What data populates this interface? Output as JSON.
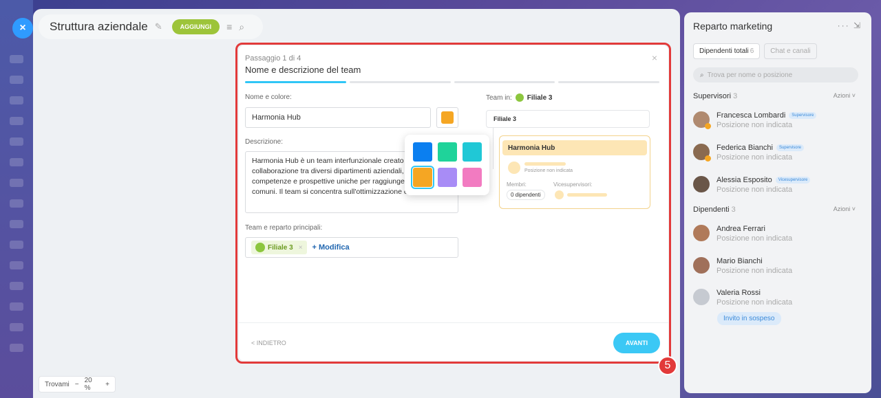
{
  "app": {
    "title": "Struttura aziendale",
    "add_label": "AGGIUNGI",
    "close_icon": "close-icon",
    "pin_icon": "pin-icon",
    "menu_icon": "menu-icon",
    "search_icon": "search-icon"
  },
  "zoom": {
    "label": "Trovami",
    "minus": "−",
    "value": "20",
    "unit": "%",
    "plus": "+"
  },
  "dialog": {
    "step": "Passaggio 1 di 4",
    "title": "Nome e descrizione del team",
    "progress": {
      "current": 1,
      "total": 4
    },
    "name_label": "Nome e colore:",
    "name_value": "Harmonia Hub",
    "selected_color": "#f5a623",
    "palette": [
      "#0b7ff0",
      "#1fd39a",
      "#20c8d6",
      "#f5a623",
      "#a88cf6",
      "#f27bc1"
    ],
    "desc_label": "Descrizione:",
    "desc_value": "Harmonia Hub è un team interfunzionale creato per la collaborazione tra diversi dipartimenti aziendali, unendo competenze e prospettive uniche per raggiungere obiettivi comuni. Il team si concentra sull'ottimizzazione e l'innovazione",
    "parent_label": "Team e reparto principali:",
    "parent_chip": "Filiale 3",
    "parent_chip_remove": "×",
    "modifica": "+ Modifica",
    "team_in_label": "Team in:",
    "team_in_value": "Filiale 3",
    "tree_root": "Filiale 3",
    "card_title": "Harmonia Hub",
    "card_position": "Posizione non indicata",
    "card_members_label": "Membri:",
    "card_members_value": "0 dipendenti",
    "card_vice_label": "Vicesupervisori:",
    "back_label": "< INDIETRO",
    "next_label": "AVANTI",
    "close": "×"
  },
  "step_badge": "5",
  "right_panel": {
    "title": "Reparto marketing",
    "more": "···",
    "tabs": [
      {
        "label": "Dipendenti totali",
        "count": "6"
      },
      {
        "label": "Chat e canali",
        "count": ""
      }
    ],
    "search_placeholder": "Trova per nome o posizione",
    "supervisors_label": "Supervisori",
    "supervisors_count": "3",
    "actions_label": "Azioni ˅",
    "supervisors": [
      {
        "name": "Francesca Lombardi",
        "badge": "Supervisore",
        "position": "Posizione non indicata"
      },
      {
        "name": "Federica Bianchi",
        "badge": "Supervisore",
        "position": "Posizione non indicata"
      },
      {
        "name": "Alessia Esposito",
        "badge": "Vicesupervisore",
        "position": "Posizione non indicata"
      }
    ],
    "employees_label": "Dipendenti",
    "employees_count": "3",
    "employees": [
      {
        "name": "Andrea Ferrari",
        "position": "Posizione non indicata"
      },
      {
        "name": "Mario Bianchi",
        "position": "Posizione non indicata"
      },
      {
        "name": "Valeria Rossi",
        "position": "Posizione non indicata"
      }
    ],
    "invite_label": "Invito in sospeso"
  }
}
